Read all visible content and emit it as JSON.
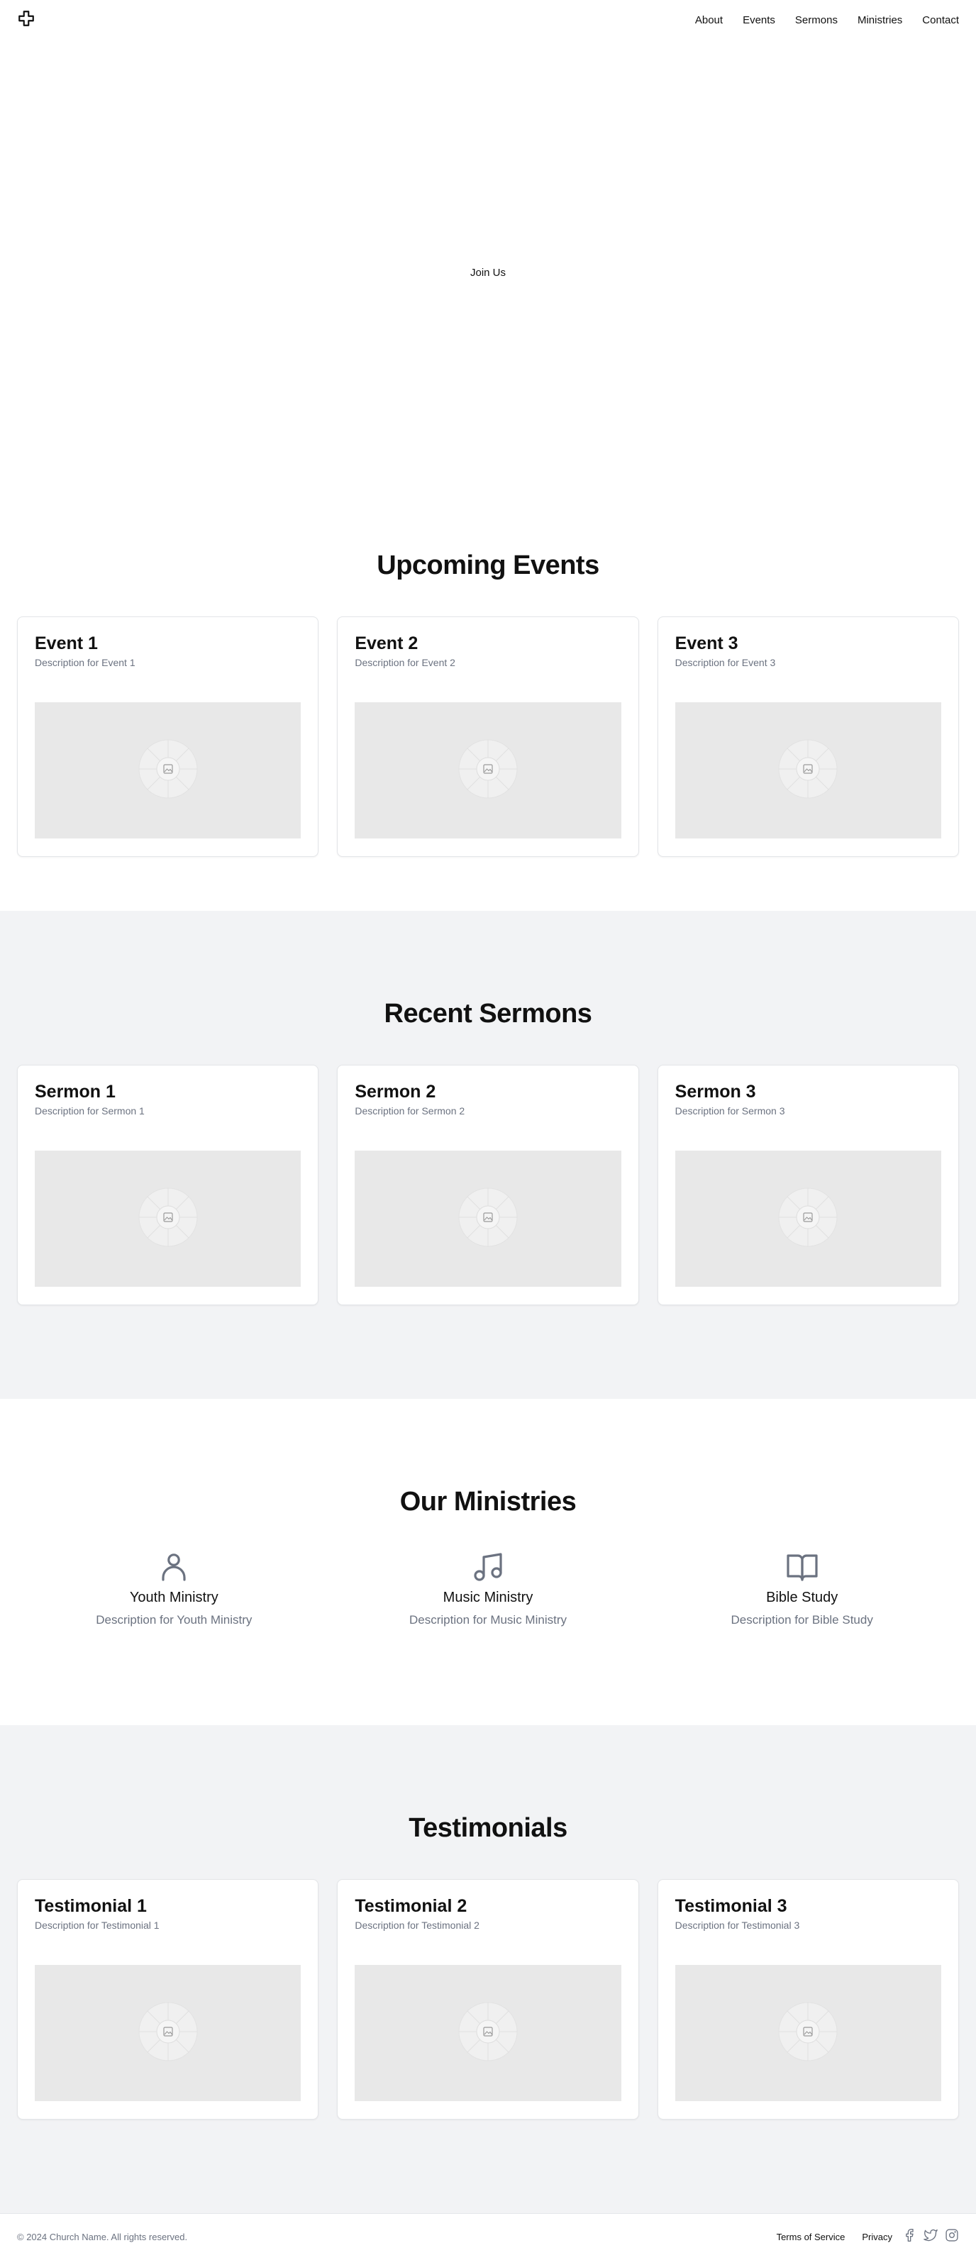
{
  "header": {
    "logo_icon": "cross-icon",
    "nav": [
      "About",
      "Events",
      "Sermons",
      "Ministries",
      "Contact"
    ]
  },
  "hero": {
    "cta_label": "Join Us"
  },
  "events": {
    "title": "Upcoming Events",
    "cards": [
      {
        "title": "Event 1",
        "description": "Description for Event 1",
        "image_icon": "image-placeholder-icon"
      },
      {
        "title": "Event 2",
        "description": "Description for Event 2",
        "image_icon": "image-placeholder-icon"
      },
      {
        "title": "Event 3",
        "description": "Description for Event 3",
        "image_icon": "image-placeholder-icon"
      }
    ]
  },
  "sermons": {
    "title": "Recent Sermons",
    "cards": [
      {
        "title": "Sermon 1",
        "description": "Description for Sermon 1",
        "image_icon": "image-placeholder-icon"
      },
      {
        "title": "Sermon 2",
        "description": "Description for Sermon 2",
        "image_icon": "image-placeholder-icon"
      },
      {
        "title": "Sermon 3",
        "description": "Description for Sermon 3",
        "image_icon": "image-placeholder-icon"
      }
    ]
  },
  "ministries": {
    "title": "Our Ministries",
    "items": [
      {
        "icon": "person-icon",
        "title": "Youth Ministry",
        "description": "Description for Youth Ministry"
      },
      {
        "icon": "music-note-icon",
        "title": "Music Ministry",
        "description": "Description for Music Ministry"
      },
      {
        "icon": "open-book-icon",
        "title": "Bible Study",
        "description": "Description for Bible Study"
      }
    ]
  },
  "testimonials": {
    "title": "Testimonials",
    "cards": [
      {
        "title": "Testimonial 1",
        "description": "Description for Testimonial 1",
        "image_icon": "image-placeholder-icon"
      },
      {
        "title": "Testimonial 2",
        "description": "Description for Testimonial 2",
        "image_icon": "image-placeholder-icon"
      },
      {
        "title": "Testimonial 3",
        "description": "Description for Testimonial 3",
        "image_icon": "image-placeholder-icon"
      }
    ]
  },
  "footer": {
    "copyright": "© 2024 Church Name. All rights reserved.",
    "links": [
      "Terms of Service",
      "Privacy"
    ],
    "social_icons": [
      "facebook-icon",
      "twitter-icon",
      "instagram-icon"
    ]
  },
  "colors": {
    "text": "#111111",
    "muted": "#6b7280",
    "alt_section_bg": "#f2f3f5",
    "image_placeholder": "#e8e8e8"
  }
}
